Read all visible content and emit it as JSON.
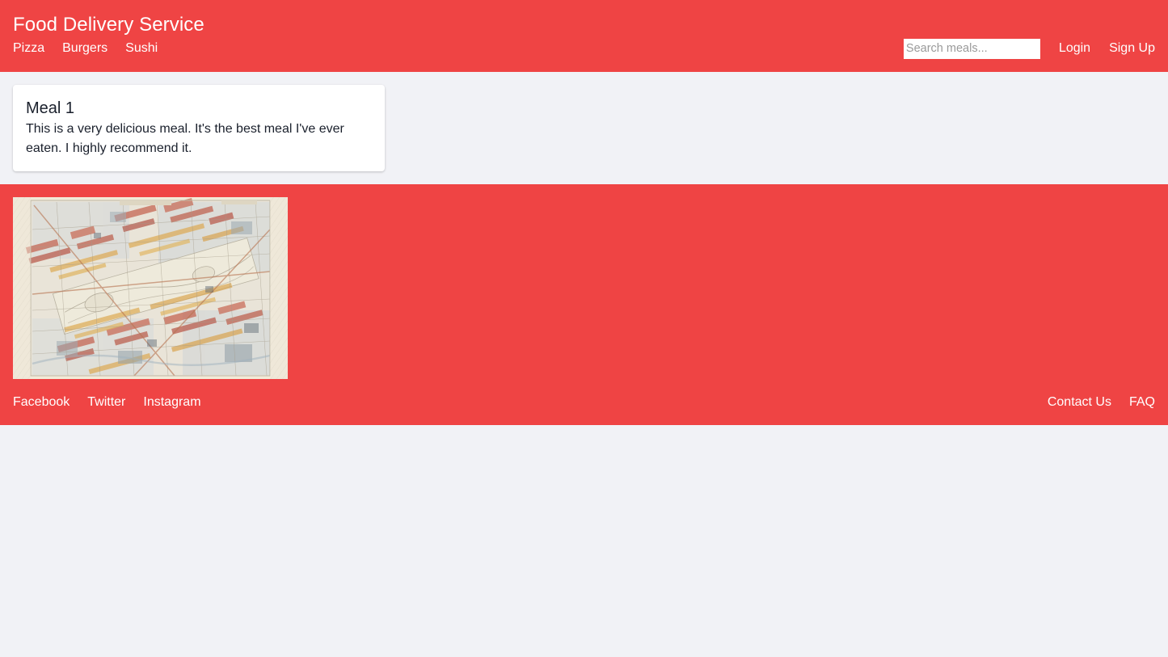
{
  "theme": {
    "brand_red": "#ef4444",
    "page_background": "#f1f2f6",
    "card_background": "#ffffff",
    "text_on_brand": "#ffffff",
    "body_text": "#1a202c"
  },
  "header": {
    "brand_title": "Food Delivery Service",
    "nav": [
      {
        "label": "Pizza"
      },
      {
        "label": "Burgers"
      },
      {
        "label": "Sushi"
      }
    ],
    "search": {
      "placeholder": "Search meals...",
      "value": ""
    },
    "auth": [
      {
        "label": "Login"
      },
      {
        "label": "Sign Up"
      }
    ]
  },
  "main": {
    "meals": [
      {
        "title": "Meal 1",
        "description": "This is a very delicious meal. It's the best meal I've ever eaten. I highly recommend it."
      }
    ]
  },
  "footer": {
    "image": {
      "alt": "Vintage city street map illustration",
      "icon_name": "antique-map-image"
    },
    "social_links": [
      {
        "label": "Facebook"
      },
      {
        "label": "Twitter"
      },
      {
        "label": "Instagram"
      }
    ],
    "support_links": [
      {
        "label": "Contact Us"
      },
      {
        "label": "FAQ"
      }
    ]
  }
}
